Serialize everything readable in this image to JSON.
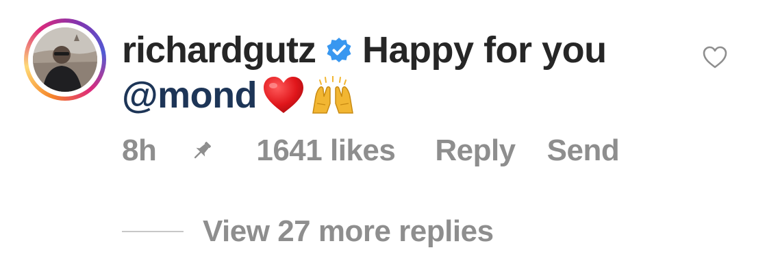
{
  "comment": {
    "username": "richardgutz",
    "verified": true,
    "text": "Happy for you",
    "mention": "@mond",
    "emojis": [
      "red-heart",
      "raising-hands"
    ],
    "time": "8h",
    "likes": "1641 likes",
    "reply_label": "Reply",
    "send_label": "Send",
    "pinned": true,
    "liked": false
  },
  "replies": {
    "view_more_label": "View 27 more replies"
  },
  "colors": {
    "text": "#262626",
    "secondary": "#8e8e8e",
    "mention": "#1d3557",
    "verified": "#3897f0",
    "heart": "#e0161b",
    "hands": "#f2b632"
  }
}
